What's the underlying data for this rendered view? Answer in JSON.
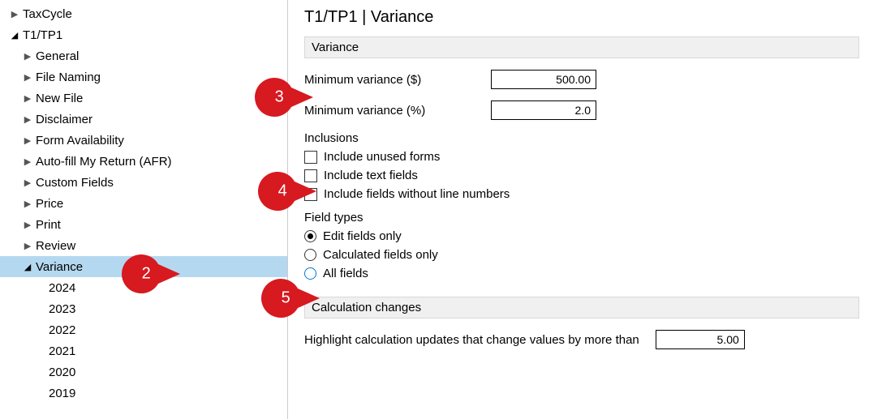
{
  "tree": {
    "taxcycle": "TaxCycle",
    "t1tp1": "T1/TP1",
    "general": "General",
    "file_naming": "File Naming",
    "new_file": "New File",
    "disclaimer": "Disclaimer",
    "form_availability": "Form Availability",
    "autofill": "Auto-fill My Return (AFR)",
    "custom_fields": "Custom Fields",
    "price": "Price",
    "print": "Print",
    "review": "Review",
    "variance": "Variance",
    "y2024": "2024",
    "y2023": "2023",
    "y2022": "2022",
    "y2021": "2021",
    "y2020": "2020",
    "y2019": "2019"
  },
  "page": {
    "title": "T1/TP1 | Variance",
    "variance_header": "Variance",
    "min_var_dollar_label": "Minimum variance ($)",
    "min_var_dollar_value": "500.00",
    "min_var_pct_label": "Minimum variance (%)",
    "min_var_pct_value": "2.0",
    "inclusions_header": "Inclusions",
    "include_unused": "Include unused forms",
    "include_text": "Include text fields",
    "include_noline": "Include fields without line numbers",
    "field_types_header": "Field types",
    "ft_edit": "Edit fields only",
    "ft_calc": "Calculated fields only",
    "ft_all": "All fields",
    "calc_header": "Calculation changes",
    "calc_highlight": "Highlight calculation updates that change values by more than",
    "calc_value": "5.00"
  },
  "callouts": {
    "c2": "2",
    "c3": "3",
    "c4": "4",
    "c5": "5"
  }
}
